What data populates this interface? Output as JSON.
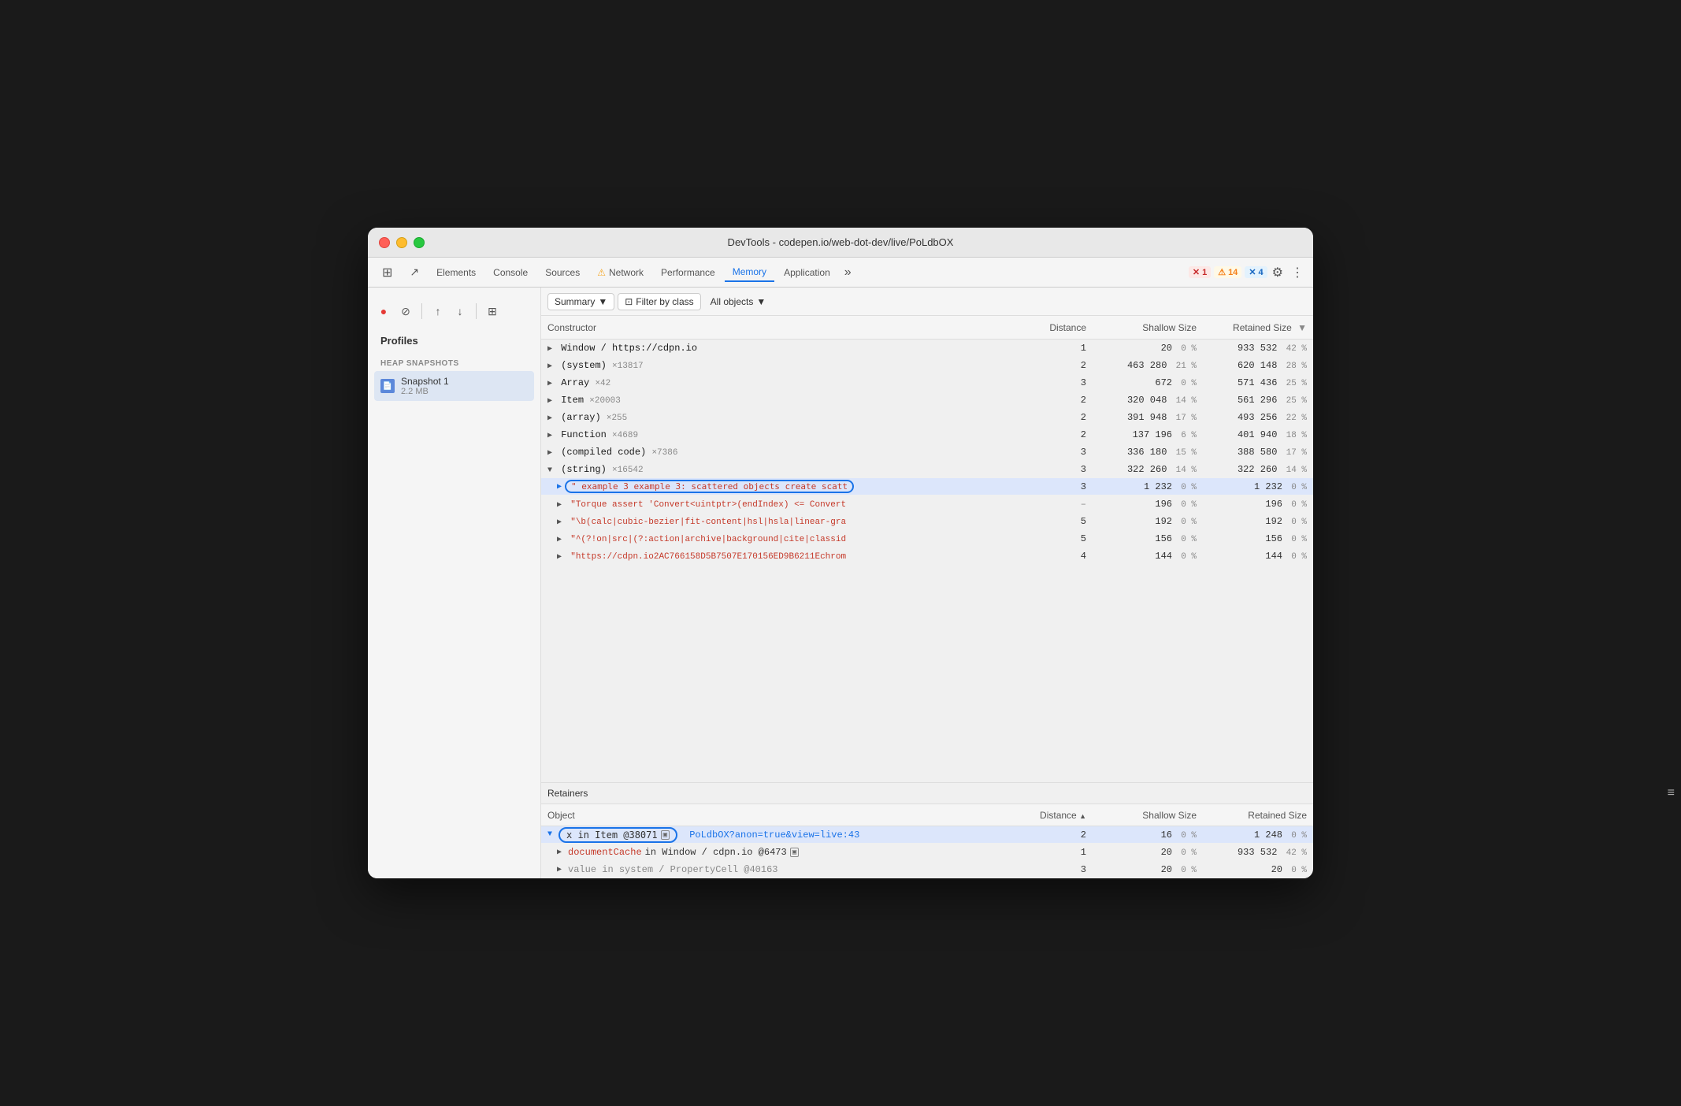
{
  "window": {
    "title": "DevTools - codepen.io/web-dot-dev/live/PoLdbOX"
  },
  "tabs": [
    {
      "id": "elements",
      "label": "Elements",
      "active": false
    },
    {
      "id": "console",
      "label": "Console",
      "active": false
    },
    {
      "id": "sources",
      "label": "Sources",
      "active": false
    },
    {
      "id": "network",
      "label": "Network",
      "active": false,
      "icon": "⚠️"
    },
    {
      "id": "performance",
      "label": "Performance",
      "active": false
    },
    {
      "id": "memory",
      "label": "Memory",
      "active": true
    },
    {
      "id": "application",
      "label": "Application",
      "active": false
    }
  ],
  "badges": {
    "errors": {
      "count": "1",
      "label": "✕ 1"
    },
    "warnings": {
      "count": "14",
      "label": "⚠ 14"
    },
    "info": {
      "count": "4",
      "label": "✕ 4"
    }
  },
  "toolbar": {
    "record_label": "●",
    "cancel_label": "⊘",
    "upload_label": "↑",
    "download_label": "↓",
    "clear_label": "⊞",
    "summary_label": "Summary",
    "filter_label": "Filter by class",
    "all_objects_label": "All objects"
  },
  "sidebar": {
    "title": "Profiles",
    "section": "HEAP SNAPSHOTS",
    "snapshot": {
      "name": "Snapshot 1",
      "size": "2.2 MB"
    }
  },
  "table": {
    "headers": {
      "constructor": "Constructor",
      "distance": "Distance",
      "shallow_size": "Shallow Size",
      "retained_size": "Retained Size"
    },
    "rows": [
      {
        "indent": 0,
        "expanded": false,
        "constructor": "Window / https://cdpn.io",
        "count": "",
        "distance": "1",
        "shallow": "20",
        "shallow_pct": "0 %",
        "retained": "933 532",
        "retained_pct": "42 %"
      },
      {
        "indent": 0,
        "expanded": false,
        "constructor": "(system)",
        "count": "×13817",
        "distance": "2",
        "shallow": "463 280",
        "shallow_pct": "21 %",
        "retained": "620 148",
        "retained_pct": "28 %"
      },
      {
        "indent": 0,
        "expanded": false,
        "constructor": "Array",
        "count": "×42",
        "distance": "3",
        "shallow": "672",
        "shallow_pct": "0 %",
        "retained": "571 436",
        "retained_pct": "25 %"
      },
      {
        "indent": 0,
        "expanded": false,
        "constructor": "Item",
        "count": "×20003",
        "distance": "2",
        "shallow": "320 048",
        "shallow_pct": "14 %",
        "retained": "561 296",
        "retained_pct": "25 %"
      },
      {
        "indent": 0,
        "expanded": false,
        "constructor": "(array)",
        "count": "×255",
        "distance": "2",
        "shallow": "391 948",
        "shallow_pct": "17 %",
        "retained": "493 256",
        "retained_pct": "22 %"
      },
      {
        "indent": 0,
        "expanded": false,
        "constructor": "Function",
        "count": "×4689",
        "distance": "2",
        "shallow": "137 196",
        "shallow_pct": "6 %",
        "retained": "401 940",
        "retained_pct": "18 %"
      },
      {
        "indent": 0,
        "expanded": false,
        "constructor": "(compiled code)",
        "count": "×7386",
        "distance": "3",
        "shallow": "336 180",
        "shallow_pct": "15 %",
        "retained": "388 580",
        "retained_pct": "17 %"
      },
      {
        "indent": 0,
        "expanded": true,
        "constructor": "(string)",
        "count": "×16542",
        "distance": "3",
        "shallow": "322 260",
        "shallow_pct": "14 %",
        "retained": "322 260",
        "retained_pct": "14 %",
        "isString": true
      },
      {
        "indent": 1,
        "expanded": false,
        "constructor": "\" example 3 example 3: scattered objects create scatt",
        "count": "",
        "distance": "3",
        "shallow": "1 232",
        "shallow_pct": "0 %",
        "retained": "1 232",
        "retained_pct": "0 %",
        "selected": true,
        "isStringItem": true
      },
      {
        "indent": 1,
        "expanded": false,
        "constructor": "\"Torque assert 'Convert<uintptr>(endIndex) <= Convert",
        "count": "",
        "distance": "–",
        "shallow": "196",
        "shallow_pct": "0 %",
        "retained": "196",
        "retained_pct": "0 %",
        "isStringItem": true
      },
      {
        "indent": 1,
        "expanded": false,
        "constructor": "\"\\b(calc|cubic-bezier|fit-content|hsl|hsla|linear-gra",
        "count": "",
        "distance": "5",
        "shallow": "192",
        "shallow_pct": "0 %",
        "retained": "192",
        "retained_pct": "0 %",
        "isStringItem": true
      },
      {
        "indent": 1,
        "expanded": false,
        "constructor": "\"^(?!on|src|(?:action|archive|background|cite|classid",
        "count": "",
        "distance": "5",
        "shallow": "156",
        "shallow_pct": "0 %",
        "retained": "156",
        "retained_pct": "0 %",
        "isStringItem": true
      },
      {
        "indent": 1,
        "expanded": false,
        "constructor": "\"https://cdpn.io2AC766158D5B7507E170156ED9B6211Echrom",
        "count": "",
        "distance": "4",
        "shallow": "144",
        "shallow_pct": "0 %",
        "retained": "144",
        "retained_pct": "0 %",
        "isStringItem": true
      }
    ]
  },
  "retainers": {
    "title": "Retainers",
    "headers": {
      "object": "Object",
      "distance": "Distance",
      "shallow_size": "Shallow Size",
      "retained_size": "Retained Size"
    },
    "rows": [
      {
        "indent": 0,
        "selected": true,
        "highlighted": true,
        "object_prefix": "x in Item @38071",
        "object_link": "PoLdbOX?anon=true&view=live:43",
        "has_node_icon": true,
        "distance": "2",
        "shallow": "16",
        "shallow_pct": "0 %",
        "retained": "1 248",
        "retained_pct": "0 %"
      },
      {
        "indent": 1,
        "selected": false,
        "object": "documentCache in Window / cdpn.io @6473",
        "has_node_icon": true,
        "distance": "1",
        "shallow": "20",
        "shallow_pct": "0 %",
        "retained": "933 532",
        "retained_pct": "42 %"
      },
      {
        "indent": 1,
        "selected": false,
        "object": "value in system / PropertyCell @40163",
        "has_node_icon": false,
        "distance": "3",
        "shallow": "20",
        "shallow_pct": "0 %",
        "retained": "20",
        "retained_pct": "0 %"
      }
    ]
  }
}
